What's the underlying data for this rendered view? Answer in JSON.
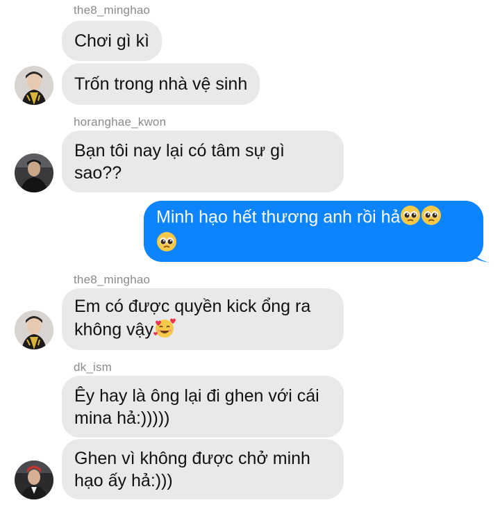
{
  "messages": [
    {
      "sender": "the8_minghao",
      "text": "Chơi gì kì"
    },
    {
      "text": "Trốn trong nhà vệ sinh",
      "avatar": "the8-minghao-avatar"
    },
    {
      "sender": "horanghae_kwon",
      "text": "Bạn tôi nay lại có tâm sự gì\nsao??",
      "avatar": "horanghae-kwon-avatar"
    },
    {
      "outgoing": true,
      "text": "Minh hạo hết thương anh rồi hả",
      "emojis": [
        "pleading-face-icon",
        "pleading-face-icon",
        "pleading-face-icon"
      ]
    },
    {
      "sender": "the8_minghao",
      "text": "Em có được quyền kick ổng ra\nkhông vậy",
      "emojis": [
        "smiling-face-with-hearts-icon"
      ],
      "avatar": "the8-minghao-avatar"
    },
    {
      "sender": "dk_ism",
      "text": "Êy hay là ông lại đi ghen với cái\nmina hả:)))))"
    },
    {
      "text": "Ghen vì không được chở minh\nhạo ấy hả:)))",
      "avatar": "dk-ism-avatar"
    }
  ],
  "colors": {
    "incoming_bubble": "#e9e9eb",
    "outgoing_bubble": "#0b84fe",
    "sender_name": "#8a8a8f"
  }
}
